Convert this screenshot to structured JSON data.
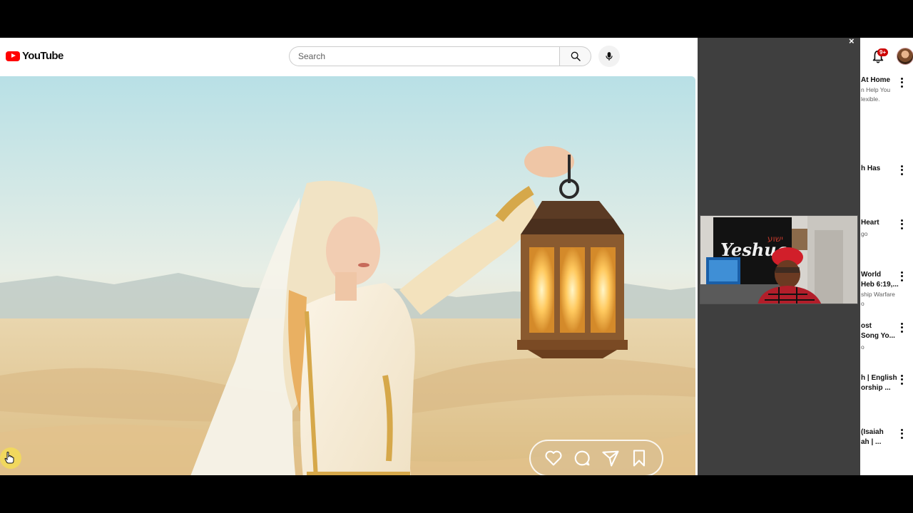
{
  "header": {
    "logo_text": "YouTube",
    "search": {
      "placeholder": "Search",
      "value": ""
    },
    "notification_count": "9+"
  },
  "colors": {
    "brand": "#ff0000",
    "overlay_gray": "#3f3f3f",
    "badge": "#cc0000"
  },
  "icons": [
    "youtube-logo-icon",
    "search-icon",
    "mic-icon",
    "heart-icon",
    "comment-icon",
    "share-icon",
    "bookmark-icon",
    "bell-icon",
    "close-icon",
    "more-vert-icon",
    "hand-pointer-icon"
  ],
  "webcam": {
    "banner_text": "Yeshua",
    "hebrew_text": "ישוע"
  },
  "sidebar": {
    "items": [
      {
        "title_lines": [
          "At Home"
        ],
        "meta_lines": [
          "n Help You",
          "lexible."
        ]
      },
      {
        "title_lines": [
          "h Has"
        ],
        "meta_lines": []
      },
      {
        "title_lines": [
          "Heart"
        ],
        "meta_lines": [
          "go"
        ]
      },
      {
        "title_lines": [
          "World",
          "Heb 6:19,..."
        ],
        "meta_lines": [
          "ship Warfare",
          "o"
        ]
      },
      {
        "title_lines": [
          "ost",
          "Song Yo..."
        ],
        "meta_lines": [
          "o"
        ]
      },
      {
        "title_lines": [
          "h | English",
          "orship ..."
        ],
        "meta_lines": []
      },
      {
        "title_lines": [
          "(Isaiah",
          "ah | ..."
        ],
        "meta_lines": []
      }
    ]
  }
}
